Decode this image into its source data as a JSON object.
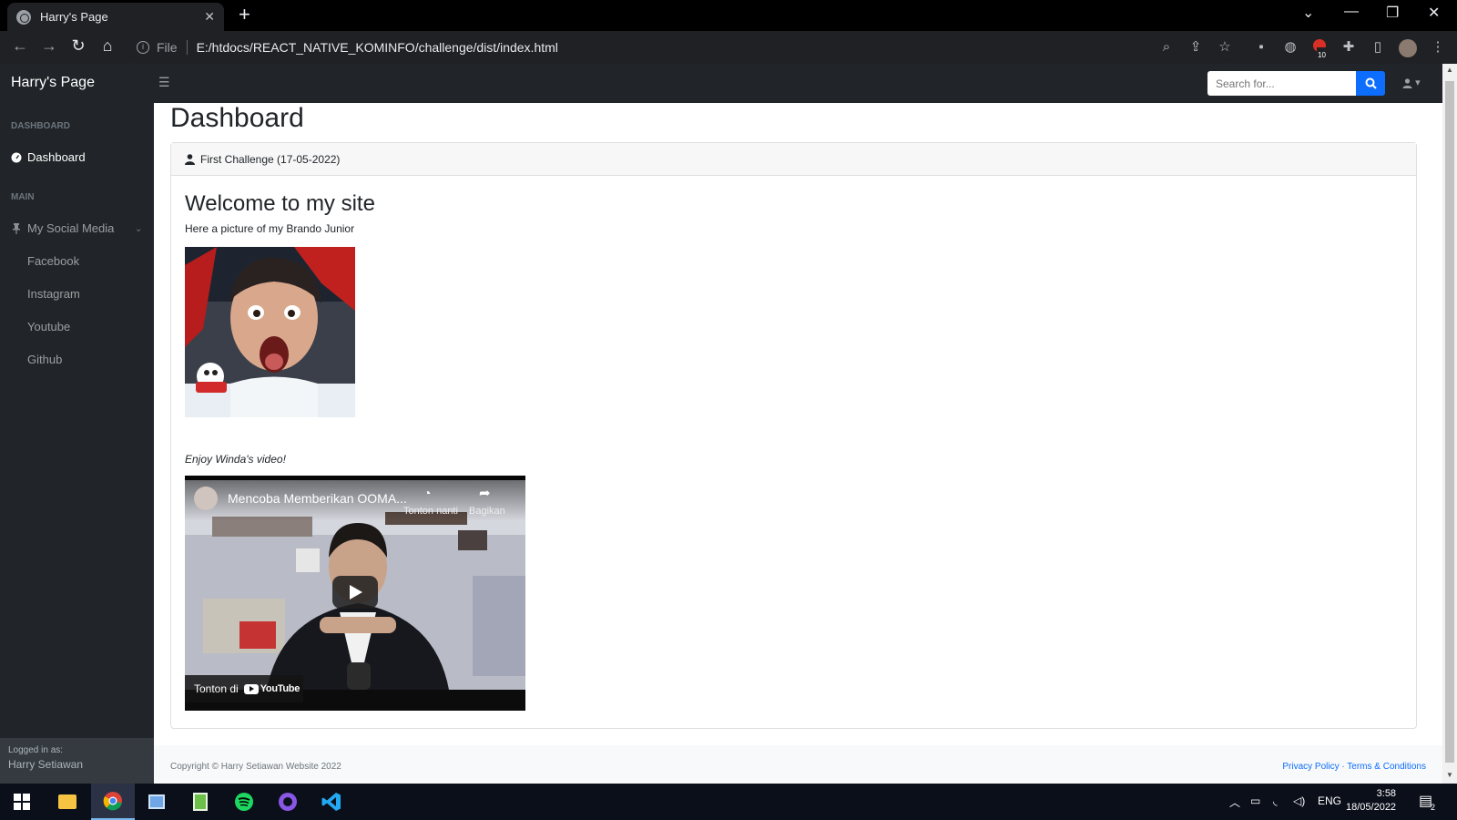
{
  "browser": {
    "tab_title": "Harry's Page",
    "tab_close": "✕",
    "new_tab": "+",
    "scheme": "File",
    "url": "E:/htdocs/REACT_NATIVE_KOMINFO/challenge/dist/index.html",
    "extension_badge": "10"
  },
  "navbar": {
    "brand": "Harry's Page",
    "search_placeholder": "Search for..."
  },
  "sidebar": {
    "heading_dashboard": "DASHBOARD",
    "dashboard_link": "Dashboard",
    "heading_main": "MAIN",
    "social_label": "My Social Media",
    "social_items": [
      "Facebook",
      "Instagram",
      "Youtube",
      "Github"
    ],
    "footer_small": "Logged in as:",
    "footer_name": "Harry Setiawan"
  },
  "main": {
    "page_title": "Dashboard",
    "card_header": "First Challenge (17-05-2022)",
    "welcome": "Welcome to my site",
    "intro": "Here a picture of my Brando Junior",
    "enjoy": "Enjoy Winda's video!"
  },
  "video": {
    "title": "Mencoba Memberikan OOMA...",
    "watch_later": "Tonton nanti",
    "share": "Bagikan",
    "watch_on": "Tonton di",
    "youtube": "YouTube"
  },
  "footer": {
    "copyright": "Copyright © Harry Setiawan Website 2022",
    "links": "Privacy Policy · Terms & Conditions"
  },
  "taskbar": {
    "lang": "ENG",
    "time": "3:58",
    "date": "18/05/2022",
    "notif_count": "2"
  },
  "colors": {
    "accent": "#0d6efd",
    "sidebar_bg": "#212529"
  }
}
